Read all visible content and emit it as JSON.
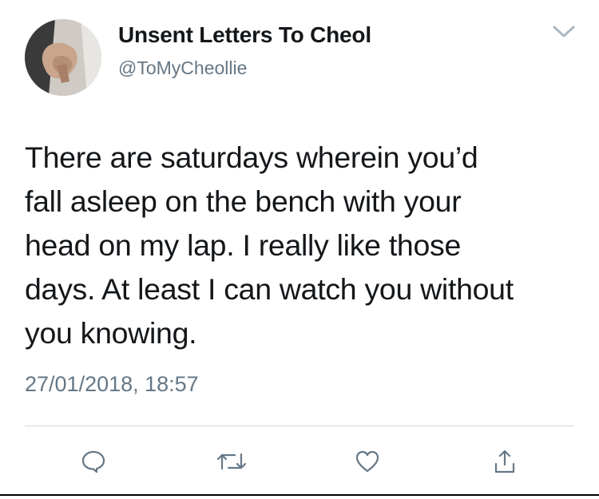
{
  "user": {
    "display_name": "Unsent Letters To Cheol",
    "handle": "@ToMyCheollie",
    "avatar_icon": "avatar-photo-hands"
  },
  "tweet": {
    "lines": [
      "There are saturdays wherein you’d",
      "fall asleep on the bench with your",
      "head on my lap. I really like those",
      "days. At least I can watch you without",
      "you knowing."
    ],
    "timestamp": "27/01/2018, 18:57"
  },
  "actions": [
    {
      "name": "reply",
      "icon": "comment-icon"
    },
    {
      "name": "retweet",
      "icon": "retweet-icon"
    },
    {
      "name": "like",
      "icon": "heart-icon"
    },
    {
      "name": "share",
      "icon": "share-icon"
    }
  ],
  "colors": {
    "text": "#14171a",
    "secondary": "#657786",
    "icon": "#657786",
    "divider": "#cfd9de"
  }
}
